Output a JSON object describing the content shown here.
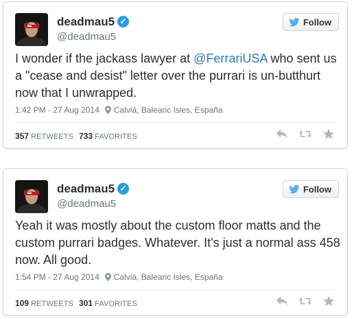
{
  "tweets": [
    {
      "display_name": "deadmau5",
      "handle": "@deadmau5",
      "follow_label": "Follow",
      "text_before": "I wonder if the jackass lawyer at ",
      "mention": "@FerrariUSA",
      "text_after": " who sent us a \"cease and desist\" letter over the purrari is un-butthurt now that I unwrapped.",
      "time": "1:42 PM - 27 Aug 2014",
      "location": "Calvià, Balearic Isles, España",
      "retweets": "357",
      "retweets_label": "RETWEETS",
      "favorites": "733",
      "favorites_label": "FAVORITES"
    },
    {
      "display_name": "deadmau5",
      "handle": "@deadmau5",
      "follow_label": "Follow",
      "text_before": "Yeah it was mostly about the custom floor matts and the custom purrari badges. Whatever. It's just a normal ass 458 now. All good.",
      "mention": "",
      "text_after": "",
      "time": "1:54 PM - 27 Aug 2014",
      "location": "Calvià, Balearic Isles, España",
      "retweets": "109",
      "retweets_label": "RETWEETS",
      "favorites": "301",
      "favorites_label": "FAVORITES"
    }
  ],
  "colors": {
    "link": "#2b7bb9",
    "verified": "#2b9ae8",
    "muted": "#66757f",
    "twitter_blue": "#55acee"
  },
  "icons": [
    "verified-badge-icon",
    "twitter-bird-icon",
    "location-pin-icon",
    "reply-icon",
    "retweet-icon",
    "favorite-star-icon"
  ]
}
